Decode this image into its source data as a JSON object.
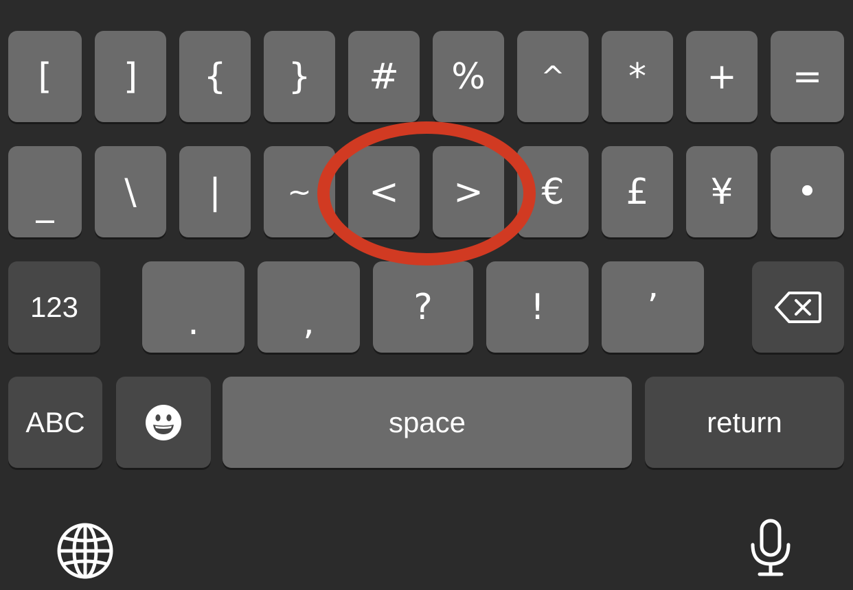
{
  "keyboard": {
    "row1": [
      "[",
      "]",
      "{",
      "}",
      "#",
      "%",
      "^",
      "*",
      "+",
      "="
    ],
    "row2": [
      "_",
      "\\",
      "|",
      "~",
      "<",
      ">",
      "€",
      "£",
      "¥",
      "•"
    ],
    "row3": [
      ".",
      ",",
      "?",
      "!",
      "’"
    ],
    "numbers_label": "123",
    "abc_label": "ABC",
    "space_label": "space",
    "return_label": "return",
    "icons": {
      "delete": "delete-backspace-icon",
      "emoji": "emoji-smile-icon",
      "globe": "globe-icon",
      "mic": "microphone-icon"
    }
  },
  "highlight": {
    "shape": "ellipse",
    "color": "#d13a22",
    "target_keys": [
      "<",
      ">"
    ]
  },
  "colors": {
    "background": "#2b2b2b",
    "key": "#6b6b6b",
    "special_key": "#474747",
    "text": "#ffffff"
  }
}
